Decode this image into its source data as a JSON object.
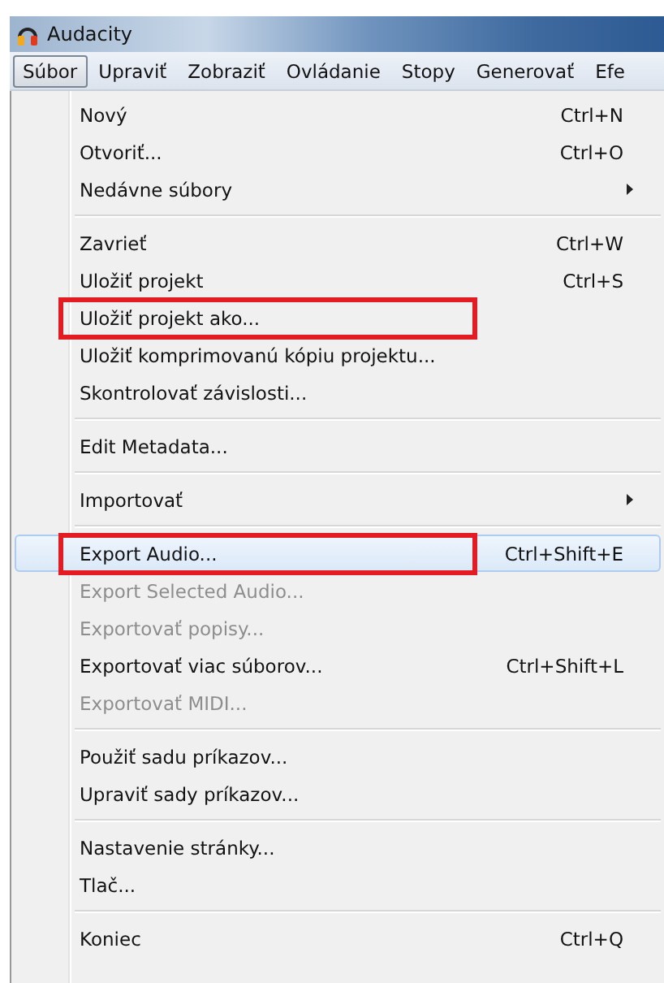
{
  "window": {
    "title": "Audacity"
  },
  "menubar": [
    {
      "label": "Súbor",
      "selected": true
    },
    {
      "label": "Upraviť",
      "selected": false
    },
    {
      "label": "Zobraziť",
      "selected": false
    },
    {
      "label": "Ovládanie",
      "selected": false
    },
    {
      "label": "Stopy",
      "selected": false
    },
    {
      "label": "Generovať",
      "selected": false
    },
    {
      "label": "Efe",
      "selected": false
    }
  ],
  "menu": [
    {
      "kind": "item",
      "label": "Nový",
      "shortcut": "Ctrl+N",
      "disabled": false,
      "selected": false,
      "annotated": false
    },
    {
      "kind": "item",
      "label": "Otvoriť...",
      "shortcut": "Ctrl+O",
      "disabled": false,
      "selected": false,
      "annotated": false
    },
    {
      "kind": "submenu",
      "label": "Nedávne súbory",
      "disabled": false,
      "selected": false,
      "annotated": false
    },
    {
      "kind": "separator"
    },
    {
      "kind": "item",
      "label": "Zavrieť",
      "shortcut": "Ctrl+W",
      "disabled": false,
      "selected": false,
      "annotated": false
    },
    {
      "kind": "item",
      "label": "Uložiť projekt",
      "shortcut": "Ctrl+S",
      "disabled": false,
      "selected": false,
      "annotated": false
    },
    {
      "kind": "item",
      "label": "Uložiť projekt ako...",
      "disabled": false,
      "selected": false,
      "annotated": true
    },
    {
      "kind": "item",
      "label": "Uložiť komprimovanú kópiu projektu...",
      "disabled": false,
      "selected": false,
      "annotated": false
    },
    {
      "kind": "item",
      "label": "Skontrolovať závislosti...",
      "disabled": false,
      "selected": false,
      "annotated": false
    },
    {
      "kind": "separator"
    },
    {
      "kind": "item",
      "label": "Edit Metadata...",
      "disabled": false,
      "selected": false,
      "annotated": false
    },
    {
      "kind": "separator"
    },
    {
      "kind": "submenu",
      "label": "Importovať",
      "disabled": false,
      "selected": false,
      "annotated": false
    },
    {
      "kind": "separator"
    },
    {
      "kind": "item",
      "label": "Export Audio...",
      "shortcut": "Ctrl+Shift+E",
      "disabled": false,
      "selected": true,
      "annotated": true
    },
    {
      "kind": "item",
      "label": "Export Selected Audio...",
      "disabled": true,
      "selected": false,
      "annotated": false
    },
    {
      "kind": "item",
      "label": "Exportovať popisy...",
      "disabled": true,
      "selected": false,
      "annotated": false
    },
    {
      "kind": "item",
      "label": "Exportovať viac súborov...",
      "shortcut": "Ctrl+Shift+L",
      "disabled": false,
      "selected": false,
      "annotated": false
    },
    {
      "kind": "item",
      "label": "Exportovať MIDI...",
      "disabled": true,
      "selected": false,
      "annotated": false
    },
    {
      "kind": "separator"
    },
    {
      "kind": "item",
      "label": "Použiť sadu príkazov...",
      "disabled": false,
      "selected": false,
      "annotated": false
    },
    {
      "kind": "item",
      "label": "Upraviť sady príkazov...",
      "disabled": false,
      "selected": false,
      "annotated": false
    },
    {
      "kind": "separator"
    },
    {
      "kind": "item",
      "label": "Nastavenie stránky...",
      "disabled": false,
      "selected": false,
      "annotated": false
    },
    {
      "kind": "item",
      "label": "Tlač...",
      "disabled": false,
      "selected": false,
      "annotated": false
    },
    {
      "kind": "separator"
    },
    {
      "kind": "item",
      "label": "Koniec",
      "shortcut": "Ctrl+Q",
      "disabled": false,
      "selected": false,
      "annotated": false
    }
  ]
}
